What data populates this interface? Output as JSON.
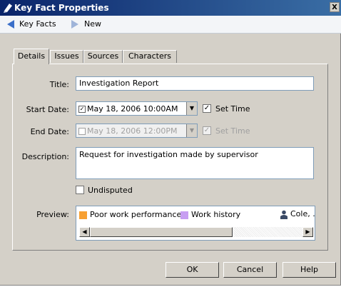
{
  "window": {
    "title": "Key Fact Properties",
    "close_label": "X"
  },
  "nav": {
    "back_label": "Key Facts",
    "forward_label": "New"
  },
  "tabs": [
    {
      "label": "Details",
      "active": true
    },
    {
      "label": "Issues"
    },
    {
      "label": "Sources"
    },
    {
      "label": "Characters"
    }
  ],
  "form": {
    "title_label": "Title:",
    "title_value": "Investigation Report",
    "start_label": "Start Date:",
    "start_value": "May 18, 2006 10:00AM",
    "start_set_time_label": "Set Time",
    "end_label": "End Date:",
    "end_value": "May 18, 2006 12:00PM",
    "end_set_time_label": "Set Time",
    "description_label": "Description:",
    "description_value": "Request for investigation made by supervisor",
    "undisputed_label": "Undisputed",
    "preview_label": "Preview:",
    "preview_items": [
      {
        "label": "Poor work performance",
        "color": "#f7a032"
      },
      {
        "label": "Work history",
        "color": "#c79ef2"
      },
      {
        "label": "Cole, ."
      }
    ]
  },
  "buttons": {
    "ok": "OK",
    "cancel": "Cancel",
    "help": "Help"
  },
  "colors": {
    "titlebar_start": "#0a246a",
    "titlebar_end": "#3a6ea5",
    "dialog_bg": "#d4d0c8"
  },
  "icons": [
    "title-app-icon",
    "back-arrow-icon",
    "forward-arrow-icon",
    "dropdown-arrow-icon",
    "person-icon",
    "scroll-left-icon",
    "scroll-right-icon"
  ]
}
